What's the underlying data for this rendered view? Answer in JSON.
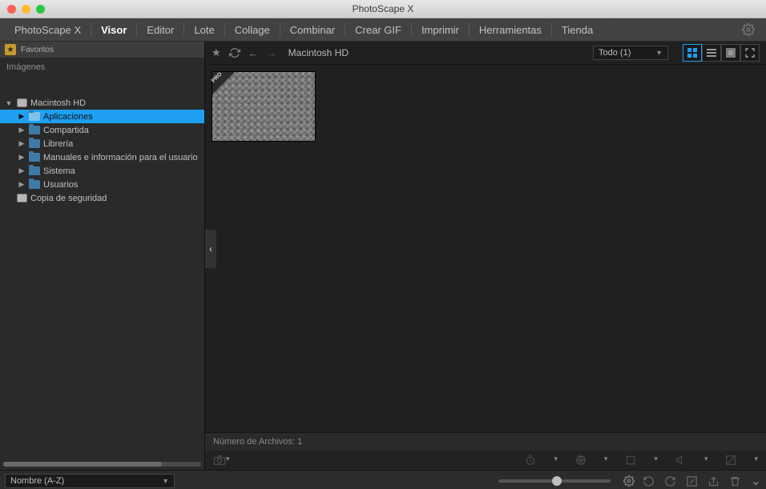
{
  "window": {
    "title": "PhotoScape X"
  },
  "tabs": {
    "app": "PhotoScape X",
    "items": [
      "Visor",
      "Editor",
      "Lote",
      "Collage",
      "Combinar",
      "Crear GIF",
      "Imprimir",
      "Herramientas",
      "Tienda"
    ],
    "active_index": 0
  },
  "sidebar": {
    "favorites_label": "Favoritos",
    "images_label": "Imágenes",
    "tree": [
      {
        "label": "Macintosh HD",
        "icon": "drive",
        "depth": 0,
        "expanded": true,
        "selected": false
      },
      {
        "label": "Aplicaciones",
        "icon": "folder",
        "depth": 1,
        "expanded": false,
        "selected": true
      },
      {
        "label": "Compartida",
        "icon": "folder",
        "depth": 1,
        "expanded": false,
        "selected": false
      },
      {
        "label": "Librería",
        "icon": "folder",
        "depth": 1,
        "expanded": false,
        "selected": false
      },
      {
        "label": "Manuales e información para el usuario",
        "icon": "folder",
        "depth": 1,
        "expanded": false,
        "selected": false
      },
      {
        "label": "Sistema",
        "icon": "folder",
        "depth": 1,
        "expanded": false,
        "selected": false
      },
      {
        "label": "Usuarios",
        "icon": "folder",
        "depth": 1,
        "expanded": false,
        "selected": false
      },
      {
        "label": "Copia de seguridad",
        "icon": "drive",
        "depth": 0,
        "expanded": false,
        "selected": false
      }
    ]
  },
  "toolbar": {
    "breadcrumb": "Macintosh HD",
    "filter_label": "Todo (1)"
  },
  "thumbnail": {
    "pro_badge": "PRO"
  },
  "status": {
    "file_count_label": "Número de Archivos: 1"
  },
  "bottom": {
    "sort_label": "Nombre (A-Z)"
  }
}
